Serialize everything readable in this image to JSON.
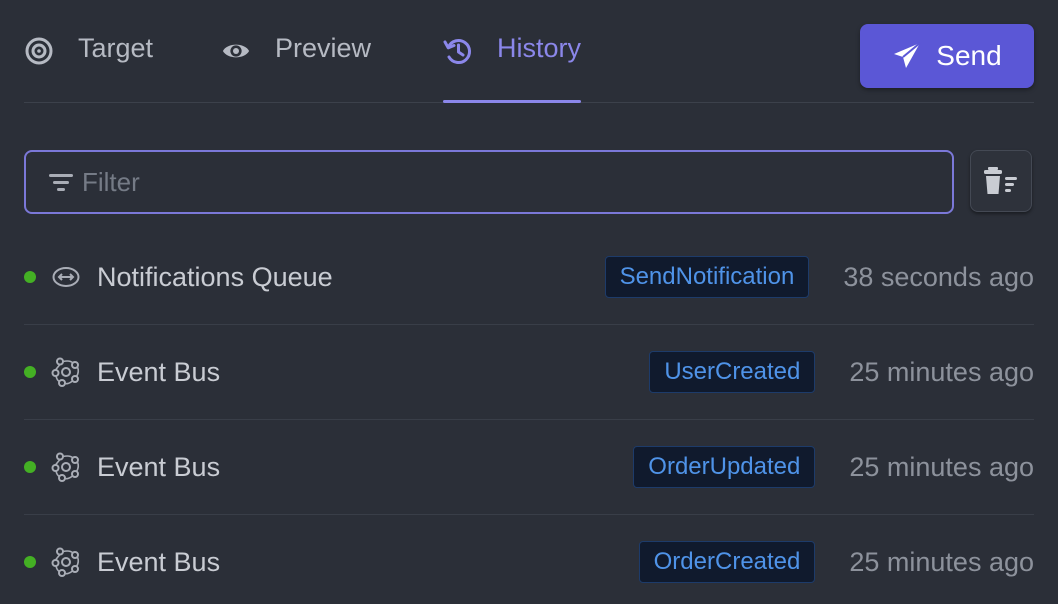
{
  "tabs": [
    {
      "label": "Target",
      "icon": "target-icon",
      "active": false
    },
    {
      "label": "Preview",
      "icon": "eye-icon",
      "active": false
    },
    {
      "label": "History",
      "icon": "history-icon",
      "active": true
    }
  ],
  "send_button": {
    "label": "Send",
    "icon": "paper-plane-icon"
  },
  "filter": {
    "placeholder": "Filter",
    "value": ""
  },
  "clear_history_button": {
    "icon": "trash-clear-icon"
  },
  "history": [
    {
      "name": "Notifications Queue",
      "kind_icon": "queue-icon",
      "message": "SendNotification",
      "time": "38 seconds ago",
      "status": "success"
    },
    {
      "name": "Event Bus",
      "kind_icon": "event-bus-icon",
      "message": "UserCreated",
      "time": "25 minutes ago",
      "status": "success"
    },
    {
      "name": "Event Bus",
      "kind_icon": "event-bus-icon",
      "message": "OrderUpdated",
      "time": "25 minutes ago",
      "status": "success"
    },
    {
      "name": "Event Bus",
      "kind_icon": "event-bus-icon",
      "message": "OrderCreated",
      "time": "25 minutes ago",
      "status": "success"
    }
  ],
  "colors": {
    "background": "#2b2f38",
    "accent": "#5b57d6",
    "active_tab": "#8b87ea",
    "badge_text": "#4f93e8",
    "status_success": "#44b024"
  }
}
